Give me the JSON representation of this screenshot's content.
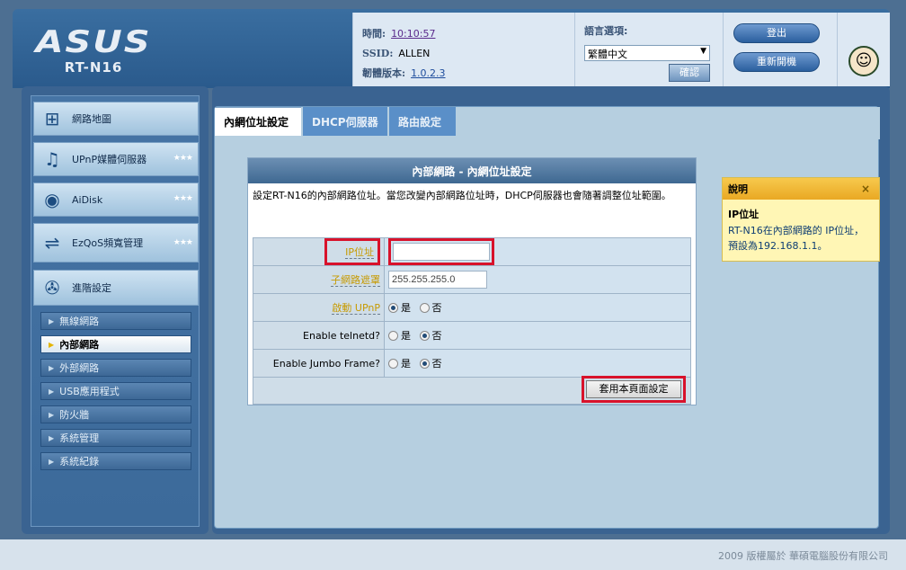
{
  "brand": {
    "logo": "/ISUS",
    "model": "RT-N16"
  },
  "header": {
    "time_label": "時間:",
    "time_value": "10:10:57",
    "ssid_label": "SSID:",
    "ssid_value": "ALLEN",
    "firmware_label": "韌體版本:",
    "firmware_value": "1.0.2.3",
    "language_label": "語言選項:",
    "language_selected": "繁體中文",
    "confirm_label": "確認",
    "logout_label": "登出",
    "reboot_label": "重新開機",
    "avatar_icon": "cartoon-face-icon"
  },
  "sidebar": {
    "main_items": [
      {
        "label": "網路地圖",
        "icon": "network-map-icon",
        "stars": false
      },
      {
        "label": "UPnP媒體伺服器",
        "icon": "media-server-icon",
        "stars": true
      },
      {
        "label": "AiDisk",
        "icon": "aidisk-icon",
        "stars": true
      },
      {
        "label": "EzQoS頻寬管理",
        "icon": "qos-icon",
        "stars": true
      },
      {
        "label": "進階設定",
        "icon": "wrench-icon",
        "stars": false
      }
    ],
    "sub_items": [
      {
        "label": "無線網路",
        "active": false
      },
      {
        "label": "內部網路",
        "active": true
      },
      {
        "label": "外部網路",
        "active": false
      },
      {
        "label": "USB應用程式",
        "active": false
      },
      {
        "label": "防火牆",
        "active": false
      },
      {
        "label": "系統管理",
        "active": false
      },
      {
        "label": "系統紀錄",
        "active": false
      }
    ]
  },
  "tabs": [
    {
      "label": "內網位址設定",
      "active": true
    },
    {
      "label": "DHCP伺服器",
      "active": false
    },
    {
      "label": "路由設定",
      "active": false
    }
  ],
  "form": {
    "title": "內部網路 - 內網位址設定",
    "description": "設定RT-N16的內部網路位址。當您改變內部網路位址時，DHCP伺服器也會隨著調整位址範圍。",
    "ip_label": "IP位址",
    "ip_value": "",
    "subnet_label": "子網路遮罩",
    "subnet_value": "255.255.255.0",
    "upnp_label": "啟動 UPnP",
    "telnet_label": "Enable telnetd?",
    "jumbo_label": "Enable Jumbo Frame?",
    "yes_label": "是",
    "no_label": "否",
    "upnp_selected": "yes",
    "telnet_selected": "no",
    "jumbo_selected": "no",
    "apply_label": "套用本頁面設定"
  },
  "help": {
    "header": "說明",
    "close": "×",
    "title": "IP位址",
    "text": "RT-N16在內部網路的 IP位址，預設為192.168.1.1。"
  },
  "footer": {
    "copyright": "2009 版權屬於 華碩電腦股份有限公司"
  },
  "colors": {
    "accent_blue": "#3a6391",
    "highlight_red": "#d8122b",
    "help_yellow": "#fff6b5"
  }
}
